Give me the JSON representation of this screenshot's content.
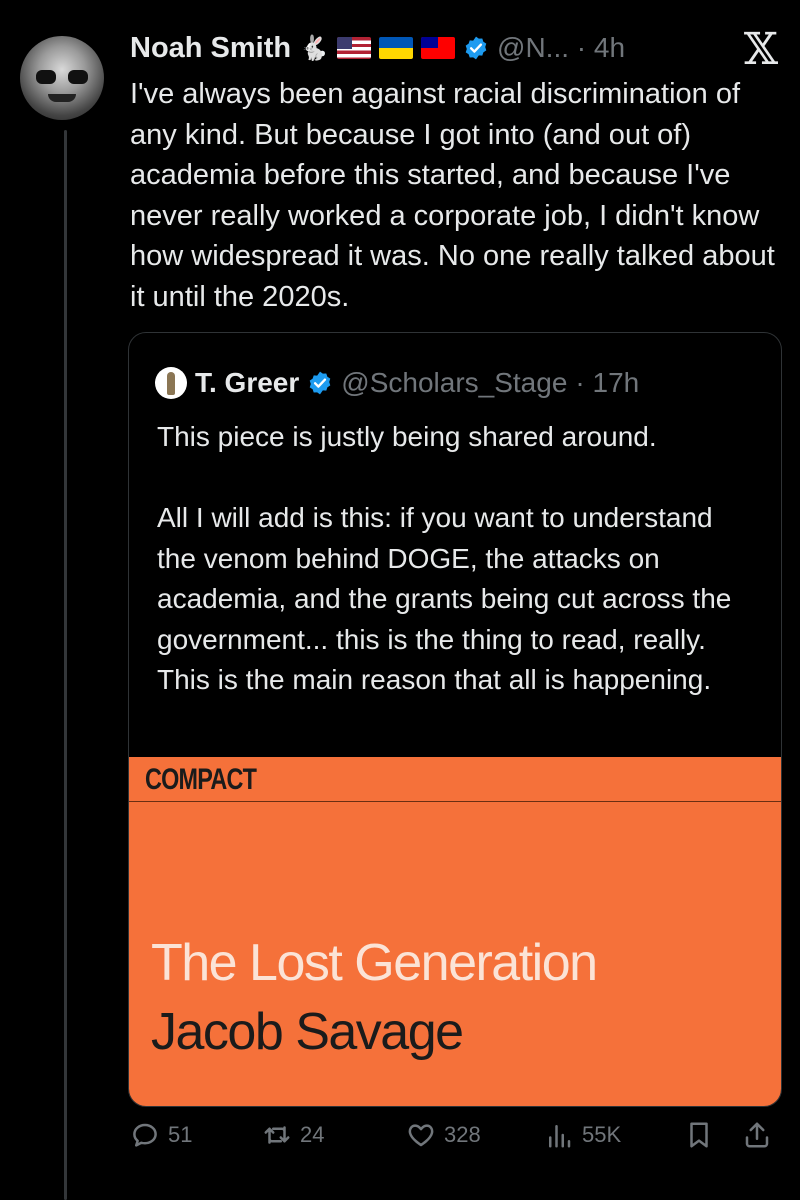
{
  "tweet": {
    "author_name": "Noah Smith",
    "handle_time": "@N... · 4h",
    "name_emoji": "🐇",
    "text": "I've always been against racial discrimination of any kind. But because I got into (and out of) academia before this started, and because I've never really worked a corporate job, I didn't know how widespread it was. No one really talked about it until the 2020s."
  },
  "quote": {
    "author_name": "T. Greer",
    "handle": "@Scholars_Stage",
    "time": "· 17h",
    "text": "This piece is justly being shared around.\n\nAll I will add is this: if you want to understand the venom behind DOGE, the attacks on academia, and the grants being cut across the government... this is the thing to read, really. This is the main reason that all is happening.",
    "card": {
      "brand": "COMPACT",
      "title": "The Lost Generation",
      "author": "Jacob Savage"
    }
  },
  "actions": {
    "replies": "51",
    "retweets": "24",
    "likes": "328",
    "views": "55K"
  },
  "icons": {
    "x": "x-logo-icon",
    "verified": "verified-badge-icon",
    "reply": "reply-icon",
    "retweet": "retweet-icon",
    "like": "heart-icon",
    "views": "views-icon",
    "bookmark": "bookmark-icon",
    "share": "share-icon"
  },
  "colors": {
    "background": "#000000",
    "text": "#e7e9ea",
    "secondary": "#71767b",
    "verified": "#1d9bf0",
    "card": "#f5713a"
  }
}
